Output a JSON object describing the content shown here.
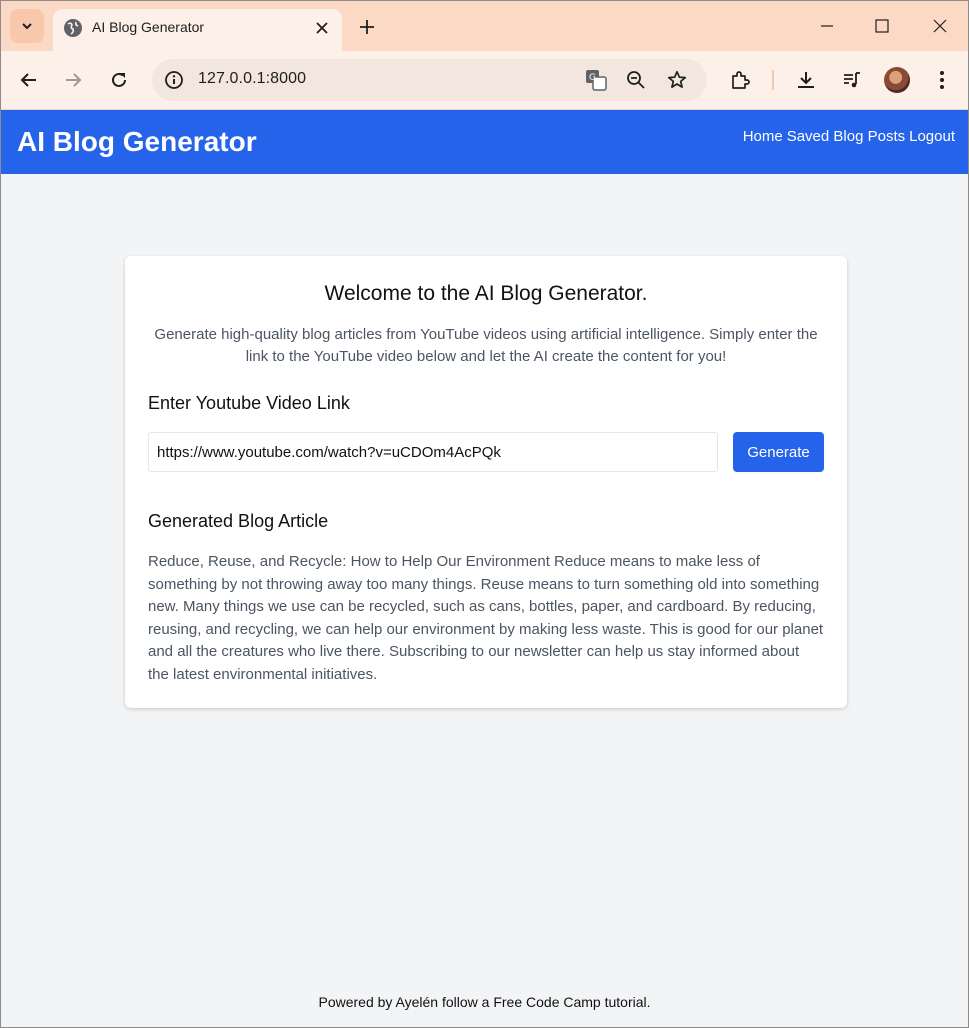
{
  "browser": {
    "tab_title": "AI Blog Generator",
    "url": "127.0.0.1:8000"
  },
  "site": {
    "title": "AI Blog Generator",
    "nav": [
      "Home",
      "Saved Blog Posts",
      "Logout"
    ],
    "accent_color": "#2563eb"
  },
  "card": {
    "heading": "Welcome to the AI Blog Generator.",
    "intro": "Generate high-quality blog articles from YouTube videos using artificial intelligence. Simply enter the link to the YouTube video below and let the AI create the content for you!",
    "link_label": "Enter Youtube Video Link",
    "link_value": "https://www.youtube.com/watch?v=uCDOm4AcPQk",
    "generate_label": "Generate",
    "article_label": "Generated Blog Article",
    "article_text": "Reduce, Reuse, and Recycle: How to Help Our Environment Reduce means to make less of something by not throwing away too many things. Reuse means to turn something old into something new. Many things we use can be recycled, such as cans, bottles, paper, and cardboard. By reducing, reusing, and recycling, we can help our environment by making less waste. This is good for our planet and all the creatures who live there. Subscribing to our newsletter can help us stay informed about the latest environmental initiatives."
  },
  "footer": "Powered by Ayelén follow a Free Code Camp tutorial.",
  "icons": [
    "tab-search-icon",
    "globe-icon",
    "close-icon",
    "plus-icon",
    "minimize-icon",
    "maximize-icon",
    "back-icon",
    "forward-icon",
    "reload-icon",
    "info-icon",
    "translate-icon",
    "zoom-out-icon",
    "star-icon",
    "extensions-icon",
    "download-icon",
    "media-icon",
    "menu-icon"
  ]
}
